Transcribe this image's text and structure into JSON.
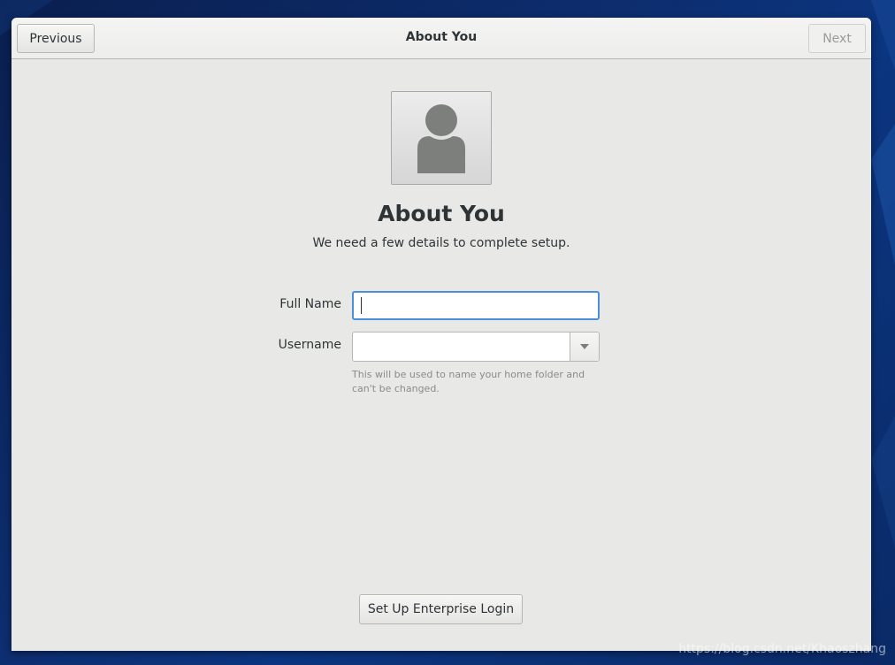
{
  "header": {
    "previous_label": "Previous",
    "title": "About You",
    "next_label": "Next"
  },
  "avatar": {
    "icon": "user-avatar-icon"
  },
  "main": {
    "title": "About You",
    "subtitle": "We need a few details to complete setup."
  },
  "form": {
    "full_name_label": "Full Name",
    "full_name_value": "",
    "username_label": "Username",
    "username_value": "",
    "username_hint": "This will be used to name your home folder and can't be changed."
  },
  "footer": {
    "enterprise_label": "Set Up Enterprise Login"
  },
  "watermark": "https://blog.csdn.net/Khaoszhang",
  "colors": {
    "accent": "#4a90d9",
    "window_bg": "#e8e8e7",
    "desktop_bg": "#0d2d6e"
  }
}
